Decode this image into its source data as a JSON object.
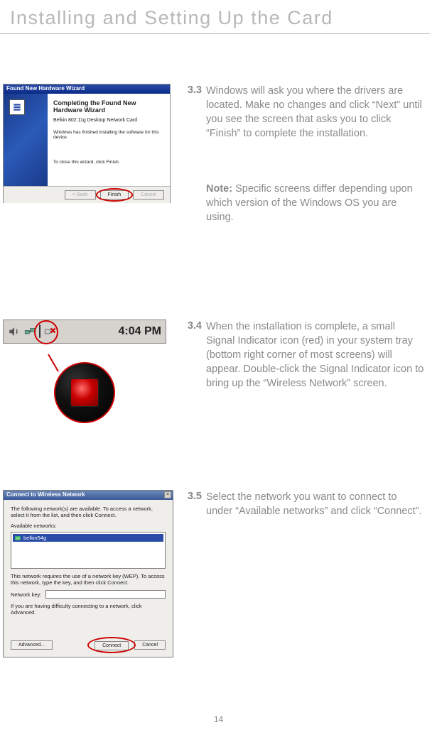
{
  "page_title": "Installing and Setting Up the Card",
  "page_number": "14",
  "steps": {
    "s33": {
      "num": "3.3",
      "text": "Windows will ask you where the drivers are located. Make no changes and click “Next” until you see the screen that asks you to click “Finish” to complete the installation."
    },
    "note": {
      "label": "Note:",
      "text": " Specific screens differ depending upon which version of the Windows OS you are using."
    },
    "s34": {
      "num": "3.4",
      "text": "When the installation is complete, a small Signal Indicator icon (red) in your system tray (bottom right corner of most screens) will appear. Double-click the Signal Indicator icon to bring up the “Wireless Network” screen."
    },
    "s35": {
      "num": "3.5",
      "text": "Select the network you want to connect to under “Available networks” and click “Connect”."
    }
  },
  "wizard": {
    "title": "Found New Hardware Wizard",
    "heading": "Completing the Found New Hardware Wizard",
    "subtitle": "Belkin 802.11g Desktop Network Card",
    "line": "Windows has finished installing the software for this device.",
    "close_line": "To close this wizard, click Finish.",
    "back": "< Back",
    "finish": "Finish",
    "cancel": "Cancel"
  },
  "tray": {
    "time": "4:04 PM"
  },
  "connect": {
    "title": "Connect to Wireless Network",
    "desc": "The following network(s) are available. To access a network, select it from the list, and then click Connect.",
    "available_label": "Available networks:",
    "network_name": "belkin54g",
    "wep_note": "This network requires the use of a network key (WEP). To access this network, type the key, and then click Connect.",
    "key_label": "Network key:",
    "difficulty": "If you are having difficulty connecting to a network, click Advanced.",
    "advanced": "Advanced...",
    "connect": "Connect",
    "cancel": "Cancel"
  }
}
